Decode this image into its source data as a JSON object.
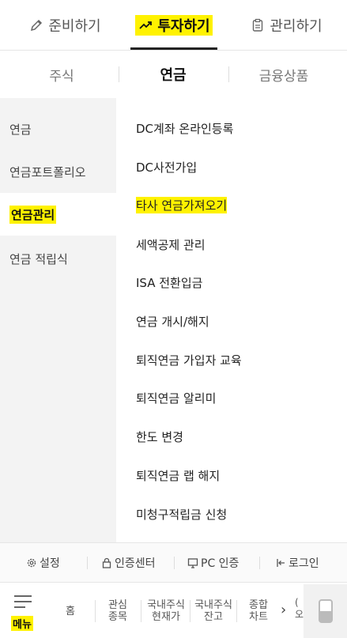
{
  "top_tabs": [
    {
      "label": "준비하기",
      "icon": "pencil-icon"
    },
    {
      "label": "투자하기",
      "icon": "trend-up-icon",
      "active": true
    },
    {
      "label": "관리하기",
      "icon": "clipboard-icon"
    }
  ],
  "sub_tabs": [
    {
      "label": "주식"
    },
    {
      "label": "연금",
      "active": true
    },
    {
      "label": "금융상품"
    }
  ],
  "left_menu": [
    {
      "label": "연금"
    },
    {
      "label": "연금포트폴리오"
    },
    {
      "label": "연금관리",
      "active": true
    },
    {
      "label": "연금 적립식"
    }
  ],
  "right_items": [
    {
      "label": "DC계좌 온라인등록"
    },
    {
      "label": "DC사전가입"
    },
    {
      "label": "타사 연금가져오기",
      "highlighted": true
    },
    {
      "label": "세액공제 관리"
    },
    {
      "label": "ISA 전환입금"
    },
    {
      "label": "연금 개시/해지"
    },
    {
      "label": "퇴직연금 가입자 교육"
    },
    {
      "label": "퇴직연금 알리미"
    },
    {
      "label": "한도 변경"
    },
    {
      "label": "퇴직연금 랩 해지"
    },
    {
      "label": "미청구적립금 신청"
    }
  ],
  "util_bar": [
    {
      "label": "설정",
      "icon": "gear-icon"
    },
    {
      "label": "인증센터",
      "icon": "lock-icon"
    },
    {
      "label": "PC 인증",
      "icon": "monitor-icon"
    },
    {
      "label": "로그인",
      "icon": "login-icon"
    }
  ],
  "bottom_nav": {
    "menu_label": "메뉴",
    "items": [
      {
        "label": "홈"
      },
      {
        "label": "관심\n종목"
      },
      {
        "label": "국내주식\n현재가"
      },
      {
        "label": "국내주식\n잔고"
      },
      {
        "label": "종합\n차트"
      }
    ],
    "cut_text": [
      "(",
      "오늘"
    ]
  },
  "colors": {
    "highlight": "#fff200",
    "active_underline": "#222222",
    "left_bg": "#f3f3f3"
  }
}
